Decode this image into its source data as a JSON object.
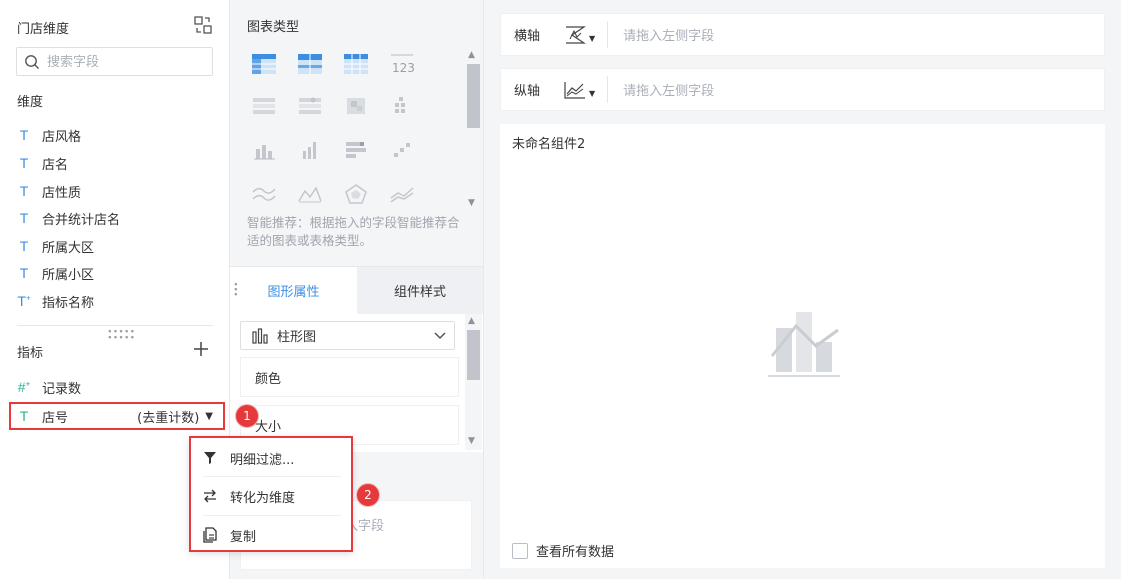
{
  "left_panel": {
    "title": "门店维度",
    "search_placeholder": "搜索字段",
    "dimensions_label": "维度",
    "dimensions": [
      {
        "label": "店风格"
      },
      {
        "label": "店名"
      },
      {
        "label": "店性质"
      },
      {
        "label": "合并统计店名"
      },
      {
        "label": "所属大区"
      },
      {
        "label": "所属小区"
      },
      {
        "label": "指标名称"
      }
    ],
    "measures_label": "指标",
    "measures": [
      {
        "label": "记录数"
      }
    ],
    "selected_measure": {
      "label": "店号",
      "aggregation": "(去重计数)"
    }
  },
  "badges": {
    "one": "1",
    "two": "2"
  },
  "context_menu": {
    "items": [
      {
        "label": "明细过滤..."
      },
      {
        "label": "转化为维度"
      },
      {
        "label": "复制"
      }
    ]
  },
  "middle_panel": {
    "chart_type_title": "图表类型",
    "hint": "智能推荐：根据拖入的字段智能推荐合适的图表或表格类型。",
    "tabs": [
      "图形属性",
      "组件样式"
    ],
    "chart_select": "柱形图",
    "properties": [
      "颜色",
      "大小"
    ],
    "drop_hint": "入字段"
  },
  "right_panel": {
    "x_axis_label": "横轴",
    "y_axis_label": "纵轴",
    "axis_placeholder": "请拖入左侧字段",
    "widget_title": "未命名组件2",
    "show_all_label": "查看所有数据"
  },
  "colors": {
    "accent": "#3d8ee0",
    "measure": "#2fb58b",
    "highlight": "#e5393b",
    "panel_bg": "#f4f5f7"
  },
  "icons": [
    "swap-icon",
    "search-icon",
    "plus-icon",
    "filter-icon",
    "convert-icon",
    "copy-icon",
    "bar-chart-icon",
    "chevron-down-icon"
  ]
}
